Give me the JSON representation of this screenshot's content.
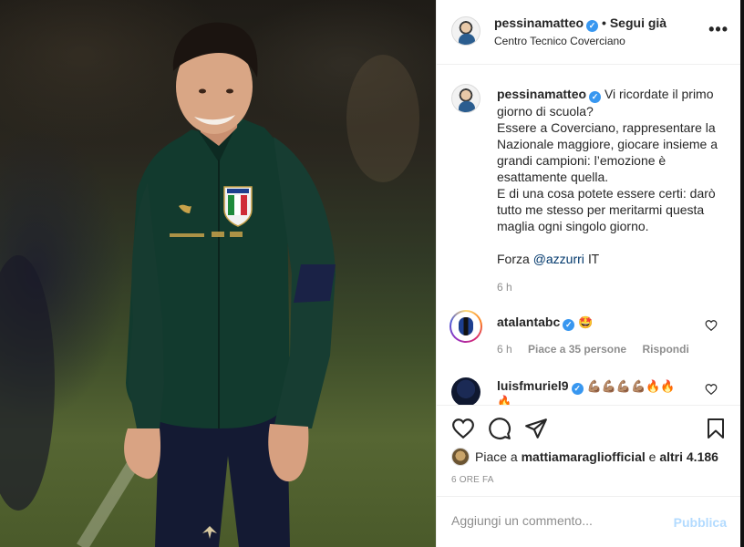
{
  "post": {
    "author": "pessinamatteo",
    "verified_mark": "✓",
    "follow_status": "• Segui già",
    "location": "Centro Tecnico Coverciano",
    "more_icon": "•••"
  },
  "caption": {
    "author": "pessinamatteo",
    "text": "Vi ricordate il primo giorno di scuola?\nEssere a Coverciano, rappresentare la Nazionale maggiore, giocare insieme a grandi campioni: l’emozione è esattamente quella.\nE di una cosa potete essere certi: darò tutto me stesso per meritarmi questa maglia ogni singolo giorno.\n\nForza ",
    "mention": "@azzurri",
    "flag": " IT",
    "time": "6 h"
  },
  "comments": [
    {
      "author": "atalantabc",
      "text": "🤩",
      "time": "6 h",
      "likes": "Piace a 35 persone",
      "reply": "Rispondi"
    },
    {
      "author": "luisfmuriel9",
      "text_muscles": "💪🏽💪🏽💪🏽💪🏽",
      "text_fire": "🔥🔥",
      "text_overflow": "🔥"
    }
  ],
  "likes": {
    "prefix": "Piace a ",
    "user": "mattiamaragliofficial",
    "mid": " e ",
    "others": "altri 4.186"
  },
  "timestamp": "6 ORE FA",
  "add_comment": {
    "placeholder": "Aggiungi un commento...",
    "publish": "Pubblica"
  },
  "colors": {
    "link": "#00376b",
    "verified": "#3897f0",
    "publish_disabled": "#b3dbff",
    "jersey": "#123a2e"
  }
}
